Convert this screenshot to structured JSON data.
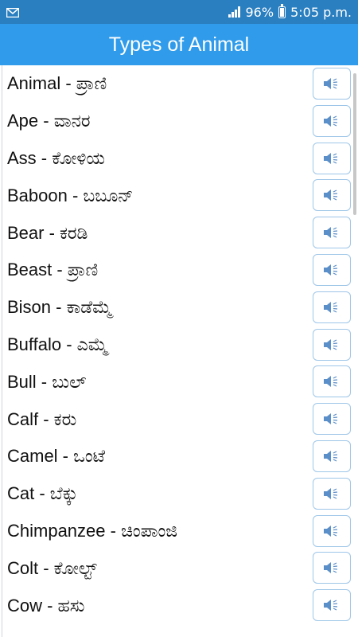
{
  "status_bar": {
    "mail_icon": "envelope-icon",
    "battery": "96%",
    "time": "5:05 p.m."
  },
  "app": {
    "title": "Types of Animal"
  },
  "items": [
    {
      "label": "Animal - ಪ್ರಾಣಿ"
    },
    {
      "label": "Ape - ವಾನರ"
    },
    {
      "label": "Ass - ಕೋಳಿಯ"
    },
    {
      "label": "Baboon - ಬಬೂನ್"
    },
    {
      "label": "Bear - ಕರಡಿ"
    },
    {
      "label": "Beast - ಪ್ರಾಣಿ"
    },
    {
      "label": "Bison - ಕಾಡೆಮ್ಮೆ"
    },
    {
      "label": "Buffalo - ಎಮ್ಮೆ"
    },
    {
      "label": "Bull - ಬುಲ್"
    },
    {
      "label": "Calf - ಕರು"
    },
    {
      "label": "Camel - ಒಂಟೆ"
    },
    {
      "label": "Cat - ಬೆಕ್ಕು"
    },
    {
      "label": "Chimpanzee - ಚಿಂಪಾಂಜಿ"
    },
    {
      "label": "Colt - ಕೋಲ್ಟ್"
    },
    {
      "label": "Cow - ಹಸು"
    }
  ],
  "colors": {
    "status_bar": "#2a7fc0",
    "app_bar": "#2f9bea",
    "speaker_icon": "#5b8fc9"
  }
}
